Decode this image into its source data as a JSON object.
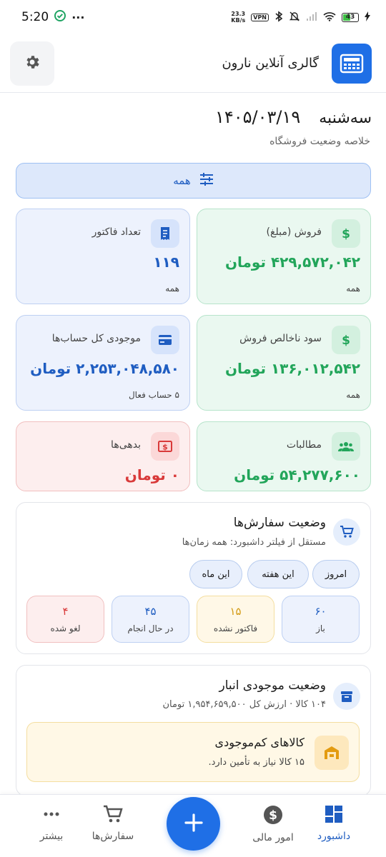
{
  "status_bar": {
    "time": "5:20",
    "dots": "···",
    "net_speed_value": "23.3",
    "net_speed_unit": "KB/s",
    "vpn": "VPN",
    "battery": "43"
  },
  "header": {
    "title": "گالری آنلاین نارون",
    "logo_icon": "cash-register-icon",
    "settings_icon": "gear-icon"
  },
  "summary": {
    "weekday": "سه‌شنبه",
    "date": "۱۴۰۵/۰۳/۱۹",
    "subtitle": "خلاصه وضعیت فروشگاه",
    "filter_label": "همه"
  },
  "cards": {
    "sales": {
      "title": "فروش (مبلغ)",
      "value": "۴۲۹,۵۷۲,۰۴۲ تومان",
      "footer": "همه",
      "icon": "dollar-icon"
    },
    "invoices": {
      "title": "تعداد فاکتور",
      "value": "۱۱۹",
      "footer": "همه",
      "icon": "receipt-icon"
    },
    "gross_profit": {
      "title": "سود ناخالص فروش",
      "value": "۱۳۶,۰۱۲,۵۴۲ تومان",
      "footer": "همه",
      "icon": "dollar-icon"
    },
    "balance": {
      "title": "موجودی کل حساب‌ها",
      "value": "۲,۲۵۳,۰۴۸,۵۸۰ تومان",
      "footer": "۵ حساب فعال",
      "icon": "credit-card-icon"
    },
    "receivables": {
      "title": "مطالبات",
      "value": "۵۴,۲۷۷,۶۰۰ تومان",
      "icon": "people-icon"
    },
    "debts": {
      "title": "بدهی‌ها",
      "value": "۰ تومان",
      "icon": "money-icon"
    }
  },
  "orders": {
    "title": "وضعیت سفارش‌ها",
    "subtitle": "مستقل از فیلتر داشبورد: همه زمان‌ها",
    "chips": [
      "امروز",
      "این هفته",
      "این ماه"
    ],
    "stats": [
      {
        "value": "۶۰",
        "label": "باز"
      },
      {
        "value": "۱۵",
        "label": "فاکتور نشده"
      },
      {
        "value": "۴۵",
        "label": "در حال انجام"
      },
      {
        "value": "۴",
        "label": "لغو شده"
      }
    ]
  },
  "inventory": {
    "title": "وضعیت موجودی انبار",
    "subtitle": "۱۰۴ کالا · ارزش کل ۱,۹۵۴,۶۵۹,۵۰۰ تومان",
    "low_stock_title": "کالاهای کم‌موجودی",
    "low_stock_sub": "۱۵ کالا نیاز به تأمین دارد."
  },
  "nav": {
    "dashboard": "داشبورد",
    "finance": "امور مالی",
    "orders": "سفارش‌ها",
    "more": "بیشتر"
  },
  "colors": {
    "primary": "#1f6fe6",
    "green": "#22a55a",
    "red": "#d93a3a",
    "amber": "#d39b17"
  }
}
